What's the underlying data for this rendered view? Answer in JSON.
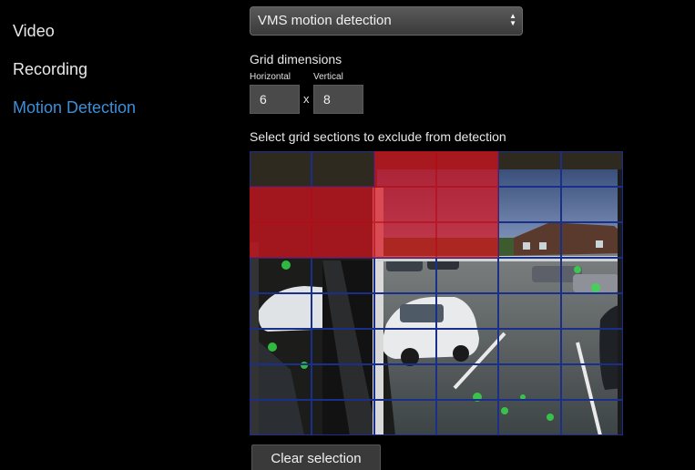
{
  "sidebar": {
    "items": [
      {
        "label": "Video",
        "active": false
      },
      {
        "label": "Recording",
        "active": false
      },
      {
        "label": "Motion Detection",
        "active": true
      }
    ]
  },
  "detection_type": {
    "selected": "VMS motion detection"
  },
  "grid_dimensions": {
    "title": "Grid dimensions",
    "horizontal_label": "Horizontal",
    "horizontal_value": "6",
    "separator": "x",
    "vertical_label": "Vertical",
    "vertical_value": "8"
  },
  "exclusion_grid": {
    "instructions": "Select grid sections to exclude from detection",
    "columns": 6,
    "rows": 8,
    "excluded_cells": [
      [
        0,
        2
      ],
      [
        0,
        3
      ],
      [
        1,
        0
      ],
      [
        1,
        1
      ],
      [
        1,
        2
      ],
      [
        1,
        3
      ],
      [
        2,
        0
      ],
      [
        2,
        1
      ],
      [
        2,
        2
      ],
      [
        2,
        3
      ]
    ],
    "grid_line_color": "#1a2f8a",
    "excluded_color": "#d7141e"
  },
  "actions": {
    "clear_label": "Clear selection"
  },
  "colors": {
    "accent": "#3d8fd8",
    "background": "#000000"
  }
}
